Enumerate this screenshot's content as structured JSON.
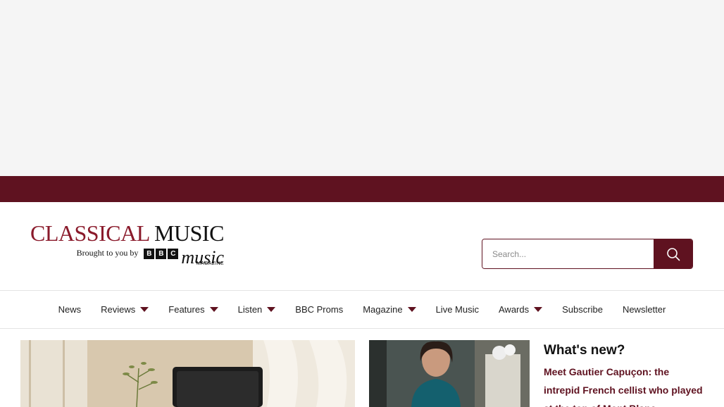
{
  "header": {
    "logo": {
      "title_part1": "CLASSICAL",
      "title_part2": "MUSIC",
      "tagline": "Brought to you by",
      "bbc_letters": [
        "B",
        "B",
        "C"
      ],
      "music_word": "music",
      "magazine_word": "MAGAZINE"
    },
    "search": {
      "placeholder": "Search..."
    }
  },
  "nav": {
    "items": [
      {
        "label": "News",
        "has_dropdown": false
      },
      {
        "label": "Reviews",
        "has_dropdown": true
      },
      {
        "label": "Features",
        "has_dropdown": true
      },
      {
        "label": "Listen",
        "has_dropdown": true
      },
      {
        "label": "BBC Proms",
        "has_dropdown": false
      },
      {
        "label": "Magazine",
        "has_dropdown": true
      },
      {
        "label": "Live Music",
        "has_dropdown": false
      },
      {
        "label": "Awards",
        "has_dropdown": true
      },
      {
        "label": "Subscribe",
        "has_dropdown": false
      },
      {
        "label": "Newsletter",
        "has_dropdown": false
      }
    ]
  },
  "content": {
    "heading": "What's new?",
    "story_title": "Meet Gautier Capuçon: the intrepid French cellist who played at the top of Mont Blanc"
  },
  "colors": {
    "brand": "#5f1220",
    "logo_accent": "#8a1a2b"
  }
}
